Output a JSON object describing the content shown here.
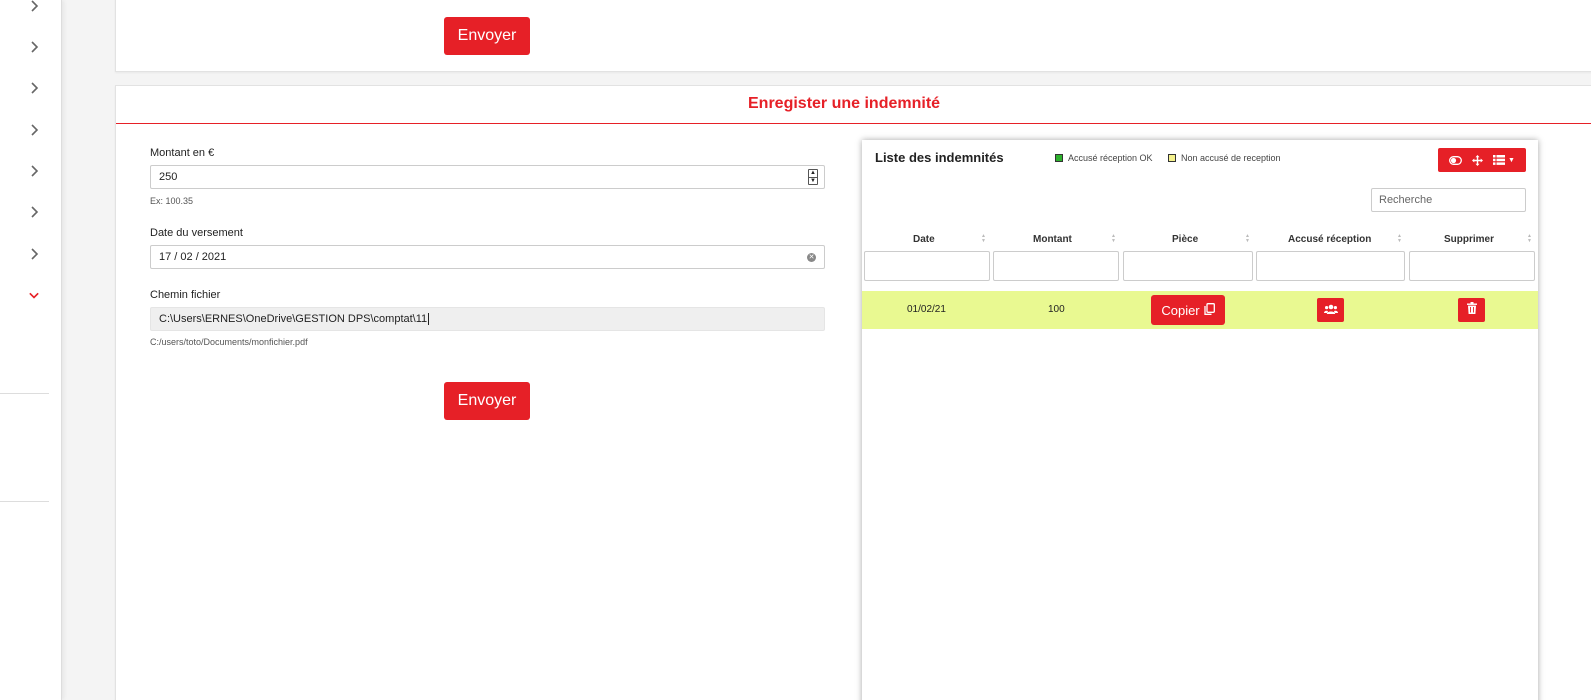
{
  "colors": {
    "accent": "#e62027",
    "row_highlight": "#e9f991",
    "legend_ok": "#2db12d",
    "legend_not_ok": "#f4f18c"
  },
  "top_card": {
    "send_label": "Envoyer"
  },
  "form": {
    "title": "Enregister une indemnité",
    "amount_label": "Montant en €",
    "amount_value": "250",
    "amount_hint": "Ex: 100.35",
    "date_label": "Date du versement",
    "date_value": "17 / 02 / 2021",
    "path_label": "Chemin fichier",
    "path_value": "C:\\Users\\ERNES\\OneDrive\\GESTION DPS\\comptat\\11",
    "path_hint": "C:/users/toto/Documents/monfichier.pdf",
    "send_label": "Envoyer"
  },
  "list": {
    "title": "Liste des indemnités",
    "legend": [
      {
        "label": "Accusé réception OK"
      },
      {
        "label": "Non accusé de reception"
      }
    ],
    "search_placeholder": "Recherche",
    "columns": [
      "Date",
      "Montant",
      "Pièce",
      "Accusé réception",
      "Supprimer"
    ],
    "rows": [
      {
        "date": "01/02/21",
        "montant": "100",
        "piece_button": "Copier"
      }
    ]
  },
  "icons": {
    "sidebar": [
      "chevron-right-icon",
      "chevron-down-icon"
    ],
    "toolbar": [
      "toggle-icon",
      "move-icon",
      "list-icon",
      "caret-down-icon"
    ],
    "row": [
      "copy-icon",
      "users-icon",
      "trash-icon"
    ]
  }
}
